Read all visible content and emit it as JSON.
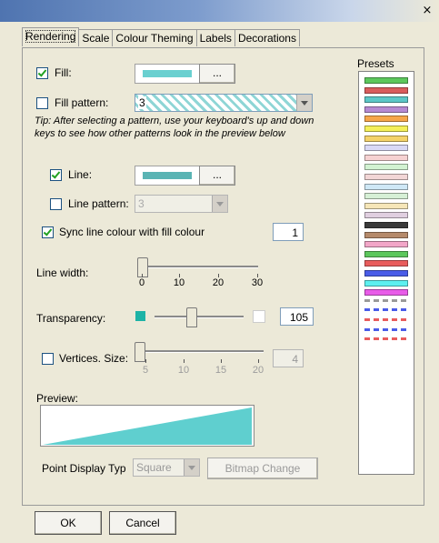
{
  "window": {
    "close_icon": "×"
  },
  "tabs": [
    {
      "label": "Rendering",
      "active": true
    },
    {
      "label": "Scale"
    },
    {
      "label": "Colour Theming"
    },
    {
      "label": "Labels"
    },
    {
      "label": "Decorations"
    }
  ],
  "rendering": {
    "fill": {
      "label": "Fill:",
      "checked": true,
      "color": "#6ad0d0",
      "button": "..."
    },
    "fill_pattern": {
      "label": "Fill pattern:",
      "checked": false,
      "value": "3"
    },
    "tip": "Tip: After selecting a pattern, use your keyboard's up and down keys to see how other patterns look in the preview below",
    "line": {
      "label": "Line:",
      "checked": true,
      "color": "#5ab4b4",
      "button": "..."
    },
    "line_pattern": {
      "label": "Line pattern:",
      "checked": false,
      "value": "3"
    },
    "sync": {
      "label": "Sync line colour with fill colour",
      "checked": true,
      "value": "1"
    },
    "line_width": {
      "label": "Line width:",
      "ticks": [
        "0",
        "10",
        "20",
        "30"
      ],
      "value": 0
    },
    "transparency": {
      "label": "Transparency:",
      "value": "105",
      "left_color": "#1db3a6",
      "right_color": "#ffffff"
    },
    "vertices": {
      "label": "Vertices. Size:",
      "checked": false,
      "ticks": [
        "5",
        "10",
        "15",
        "20"
      ],
      "value": "4"
    },
    "preview": {
      "label": "Preview:",
      "color": "#5fcfcf"
    },
    "point_display": {
      "label": "Point Display Typ",
      "value": "Square",
      "bitmap_button": "Bitmap Change"
    }
  },
  "presets": {
    "label": "Presets",
    "colors": [
      "#5cc75c",
      "#d95c5c",
      "#5cc7c7",
      "#b68ad2",
      "#f6a64a",
      "#f4f05a",
      "#f4d36a",
      "#d9d9f6",
      "#f6d2d2",
      "#d2f2d2",
      "#f2d6d6",
      "#cfe8f6",
      "#d6f0d6",
      "#f6e6b8",
      "#e0cfe0",
      "#3a3a3a",
      "#b58a6b",
      "#f2a6c8",
      "#5cc75c",
      "#e85c5c",
      "#4a5ce8",
      "#5cf0f0",
      "#e85ce8"
    ],
    "dashed": [
      "#9a9a9a",
      "#4a5ce8",
      "#e85c5c",
      "#4a5ce8",
      "#e85c5c"
    ]
  },
  "footer": {
    "ok": "OK",
    "cancel": "Cancel"
  }
}
